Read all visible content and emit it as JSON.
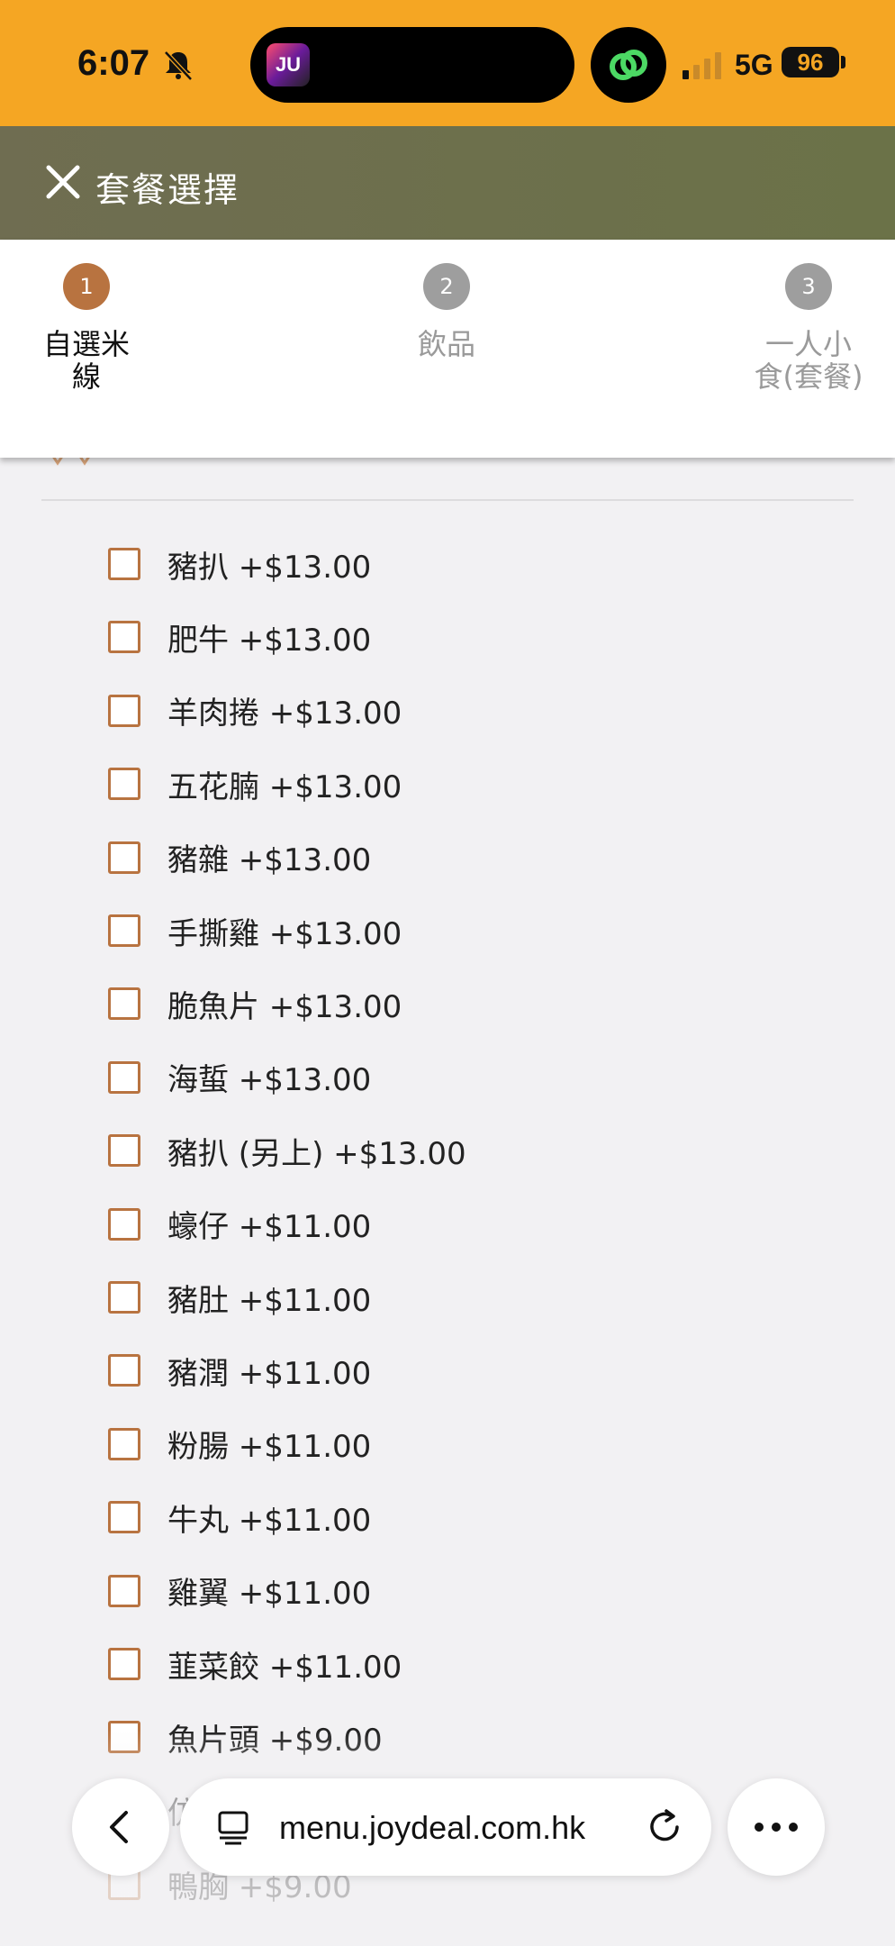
{
  "status_bar": {
    "time": "6:07",
    "network": "5G",
    "battery": "96",
    "island_app": "JU"
  },
  "header": {
    "title": "套餐選擇"
  },
  "steps": [
    {
      "number": "1",
      "label": "自選米線",
      "active": true
    },
    {
      "number": "2",
      "label": "飲品",
      "active": false
    },
    {
      "number": "3",
      "label": "一人小食(套餐)",
      "active": false
    }
  ],
  "options": [
    "豬扒 +$13.00",
    "肥牛 +$13.00",
    "羊肉捲 +$13.00",
    "五花腩 +$13.00",
    "豬雜 +$13.00",
    "手撕雞 +$13.00",
    "脆魚片 +$13.00",
    "海蜇 +$13.00",
    "豬扒 (另上) +$13.00",
    "蠔仔 +$11.00",
    "豬肚 +$11.00",
    "豬潤 +$11.00",
    "粉腸 +$11.00",
    "牛丸 +$11.00",
    "雞翼 +$11.00",
    "韮菜餃 +$11.00",
    "魚片頭 +$9.00",
    "仿",
    "鴨胸 +$9.00"
  ],
  "browser": {
    "url": "menu.joydeal.com.hk"
  },
  "colors": {
    "accent": "#b87340",
    "status_bar": "#f5a623",
    "header": "#6f6d51"
  }
}
